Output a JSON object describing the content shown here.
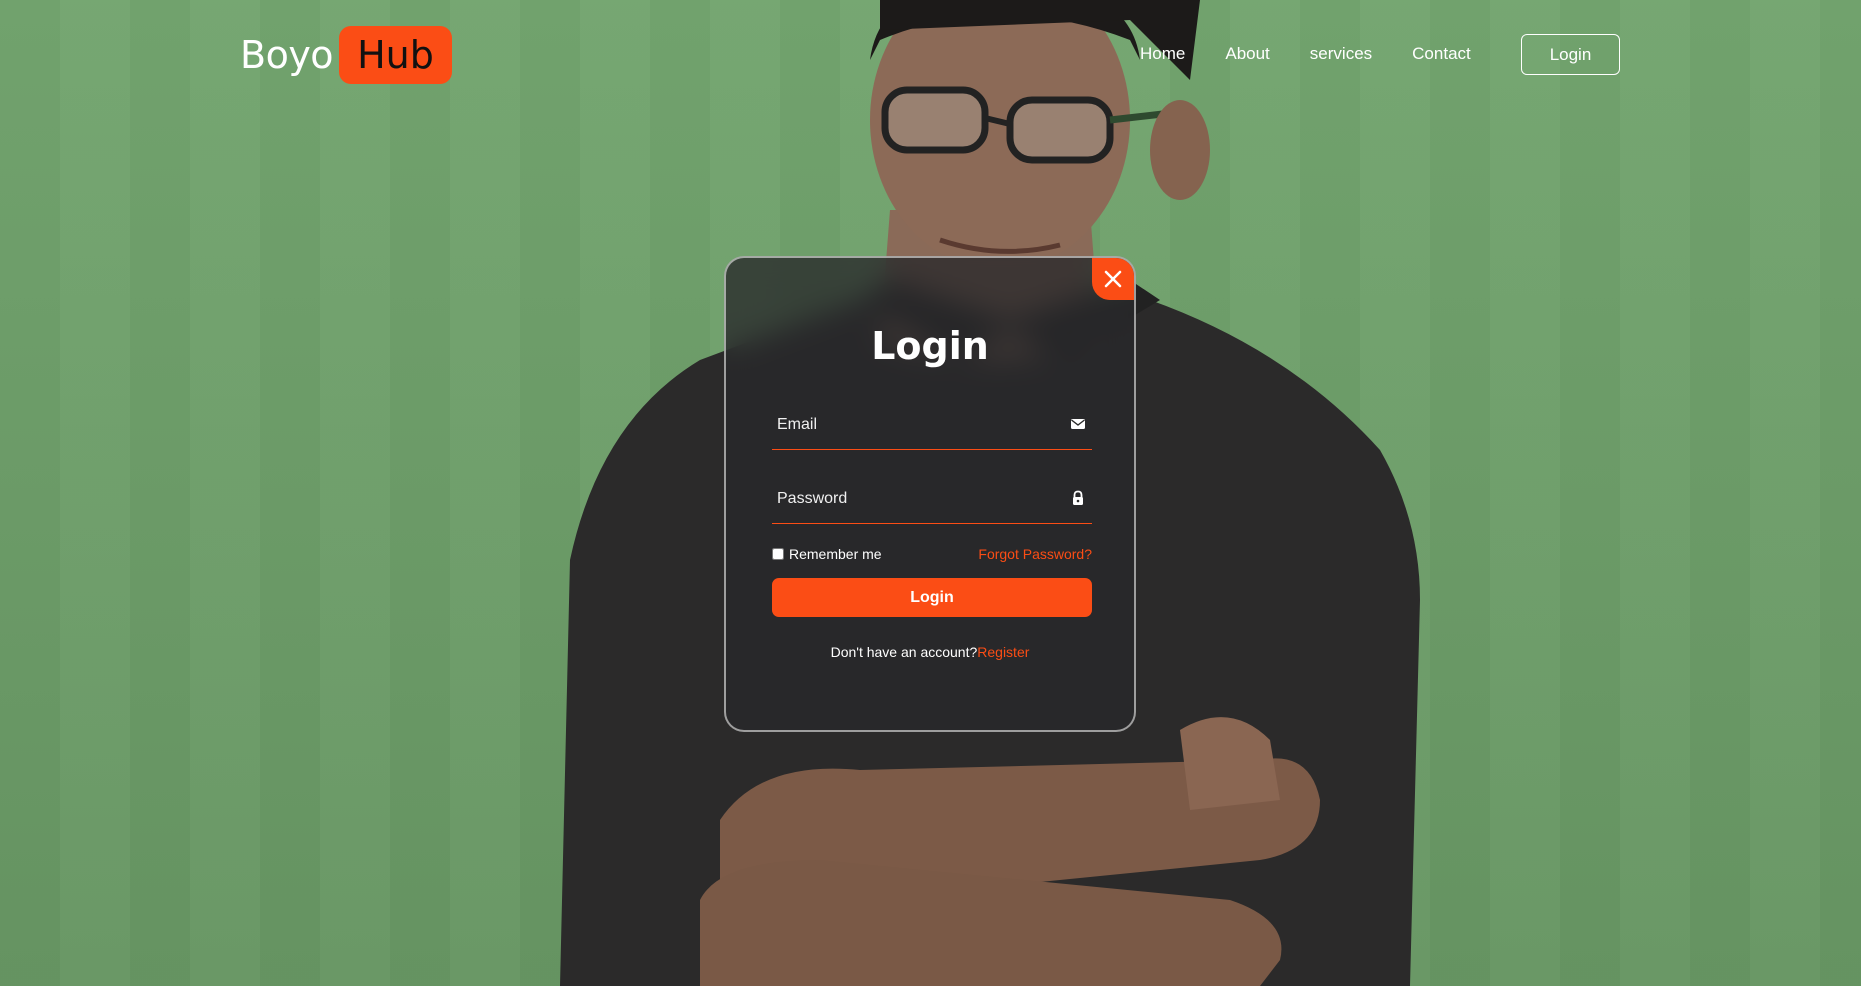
{
  "colors": {
    "accent": "#fb4d15",
    "background": "#6e9f6b",
    "modal_bg": "#28282a"
  },
  "header": {
    "logo": {
      "part1": "Boyo",
      "part2": "Hub"
    },
    "nav": [
      {
        "label": "Home"
      },
      {
        "label": "About"
      },
      {
        "label": "services"
      },
      {
        "label": "Contact"
      }
    ],
    "login_label": "Login"
  },
  "modal": {
    "close_icon": "close-icon",
    "title": "Login",
    "email": {
      "placeholder": "Email",
      "icon": "envelope-icon",
      "value": ""
    },
    "password": {
      "placeholder": "Password",
      "icon": "lock-icon",
      "value": ""
    },
    "remember_label": "Remember me",
    "remember_checked": false,
    "forgot_label": "Forgot Password?",
    "submit_label": "Login",
    "register_prompt": "Don't have an account?",
    "register_label": "Register"
  }
}
